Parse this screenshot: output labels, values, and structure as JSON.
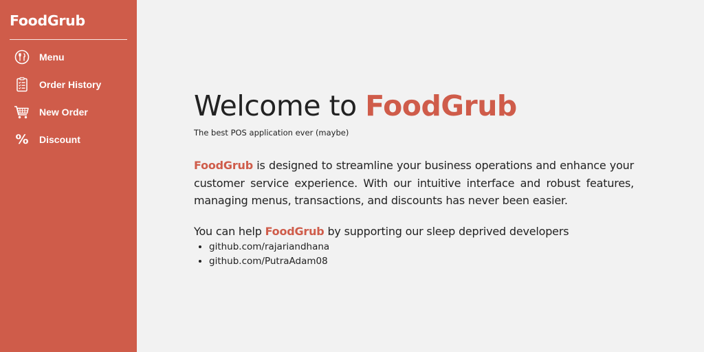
{
  "sidebar": {
    "brand": "FoodGrub",
    "items": [
      {
        "label": "Menu",
        "icon": "fork-knife-icon"
      },
      {
        "label": "Order History",
        "icon": "clipboard-list-icon"
      },
      {
        "label": "New Order",
        "icon": "cart-icon"
      },
      {
        "label": "Discount",
        "icon": "percent-icon"
      }
    ],
    "discount_symbol": "%"
  },
  "main": {
    "welcome_prefix": "Welcome to",
    "welcome_brand": "FoodGrub",
    "tagline": "The best POS application ever (maybe)",
    "description": {
      "brand": "FoodGrub",
      "text": " is designed to streamline your business operations and enhance your customer service experience. With our intuitive interface and robust features, managing menus, transactions, and discounts has never been easier."
    },
    "help": {
      "prefix": "You can help ",
      "brand": "FoodGrub",
      "suffix": " by supporting our sleep deprived developers"
    },
    "links": [
      "github.com/rajariandhana",
      "github.com/PutraAdam08"
    ]
  },
  "colors": {
    "accent": "#cf5c4a",
    "background": "#f2f2f2",
    "text": "#222222"
  }
}
